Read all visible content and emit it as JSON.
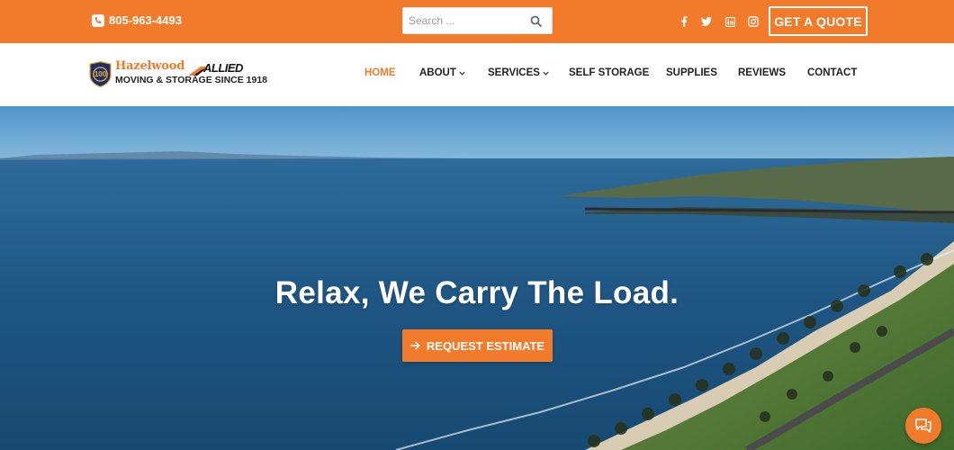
{
  "topbar": {
    "phone": "805-963-4493",
    "search_placeholder": "Search ...",
    "cta_label": "GET A QUOTE",
    "social": [
      "facebook-icon",
      "twitter-icon",
      "linkedin-icon",
      "instagram-icon"
    ]
  },
  "logo": {
    "badge_text": "100",
    "name": "Hazelwood",
    "partner": "ALLIED",
    "tagline": "MOVING & STORAGE SINCE 1918"
  },
  "nav": {
    "items": [
      {
        "label": "HOME",
        "active": true
      },
      {
        "label": "ABOUT",
        "dropdown": true
      },
      {
        "label": "SERVICES",
        "dropdown": true
      },
      {
        "label": "SELF STORAGE"
      },
      {
        "label": "SUPPLIES"
      },
      {
        "label": "REVIEWS"
      },
      {
        "label": "CONTACT"
      }
    ]
  },
  "hero": {
    "title": "Relax, We Carry The Load.",
    "button_label": "REQUEST ESTIMATE"
  },
  "colors": {
    "accent": "#f27a2b",
    "text": "#222222"
  },
  "icons": {
    "phone": "phone-icon",
    "search": "search-icon",
    "estimate": "arrow-right-icon",
    "chat": "chat-icon"
  }
}
